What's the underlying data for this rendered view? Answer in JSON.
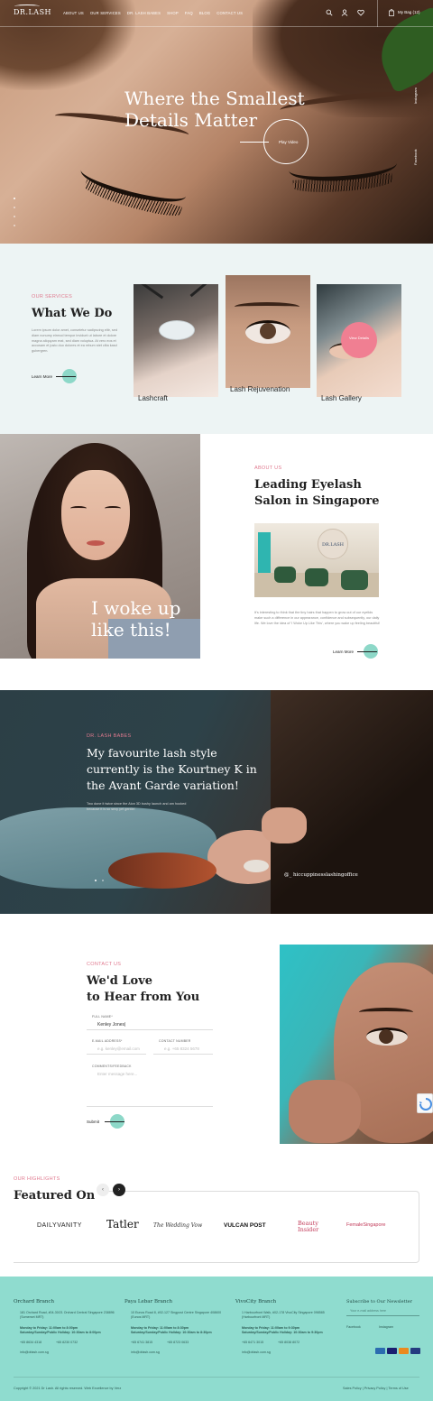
{
  "brand": {
    "logo": "DR.LASH",
    "accent_pink": "#e07a8f",
    "accent_mint": "#8dd8c8",
    "footer_bg": "#8fdccf"
  },
  "nav": {
    "items": [
      "ABOUT US",
      "OUR SERVICES",
      "DR. LASH BABES",
      "SHOP",
      "FAQ",
      "BLOG",
      "CONTACT US"
    ],
    "icons": [
      "search-icon",
      "user-icon",
      "heart-icon"
    ],
    "bag_label": "My Bag (12)"
  },
  "hero": {
    "title_line1": "Where the Smallest",
    "title_line2": "Details Matter",
    "play_label": "Play Video",
    "social_instagram": "Instagram",
    "social_facebook": "Facebook"
  },
  "services": {
    "eyebrow": "OUR SERVICES",
    "title": "What We Do",
    "body": "Lorem ipsum dolor amet, consetetur sadipscing elitr, sed diam nonumy eirmod tempor invidunt ut labore et dolore magna aliquyam erat, sed diam voluptua. At vero eos et accusam et justo duo dolores et ea rebum stet clita kasd gubergren.",
    "learn_more": "Learn More",
    "cards": [
      {
        "label": "Lashcraft"
      },
      {
        "label": "Lash Rejuvenation"
      },
      {
        "label": "Lash Gallery"
      }
    ],
    "view_details": "View Details"
  },
  "about": {
    "photo_caption_line1": "I woke up",
    "photo_caption_line2": "like this!",
    "eyebrow": "ABOUT US",
    "title": "Leading Eyelash Salon in Singapore",
    "salon_sign": "DR.LASH",
    "body": "It's interesting to think that the tiny hairs that happen to grow out of our eyelids make such a difference in our appearance, confidence and subsequently, our daily life. We love the idea of 'I Woke Up Like This', where you wake up feeling beautiful!",
    "learn_more": "Learn More"
  },
  "babes": {
    "eyebrow": "DR. LASH BABES",
    "quote": "My favourite lash style currently is the Kourtney K in the Avant Garde variation!",
    "body": "Two done it twice since the Aion 3D bushy launch and am hooked because it is so sexy yet gentle!",
    "handle": "@_ hiccuppinesslashingoffice"
  },
  "contact": {
    "eyebrow": "CONTACT US",
    "title_line1": "We'd Love",
    "title_line2": "to Hear from You",
    "fields": {
      "full_name_label": "FULL NAME*",
      "full_name_value": "Kenley Jones|",
      "email_label": "E-MAIL ADDRESS*",
      "email_placeholder": "e.g. kenley@email.com",
      "contact_label": "CONTACT NUMBER",
      "contact_placeholder": "e.g. +65 8324 5678",
      "comments_label": "COMMENTS/FEEDBACK",
      "comments_placeholder": "Enter message here..."
    },
    "submit": "Submit"
  },
  "featured": {
    "eyebrow": "OUR HIGHLIGHTS",
    "title": "Featured On",
    "prev_icon": "chevron-left-icon",
    "next_icon": "chevron-right-icon",
    "logos": [
      "DAILYVANITY",
      "Tatler",
      "The Wedding Vow",
      "VULCAN POST",
      "Beauty Insider",
      "FemaleSingapore"
    ]
  },
  "footer": {
    "branches": [
      {
        "name": "Orchard Branch",
        "address": "181 Orchard Road, #04-30/21 Orchard Central Singapore 238896 (Somerset MRT)",
        "hours_weekday": "Monday to Friday: 11:00am to 8:00pm",
        "hours_weekend": "Saturday/Sunday/Public Holiday: 10:30am to 8:00pm",
        "phone": "+65 8634 4318",
        "whatsapp": "+65 8230 0732",
        "email": "info@drlash.com.sg"
      },
      {
        "name": "Paya Lebar Branch",
        "address": "10 Eunos Road 8, #02-127 Singpost Centre Singapore 408600 (Eunos MRT)",
        "hours_weekday": "Monday to Friday: 11:00am to 8:30pm",
        "hours_weekend": "Saturday/Sunday/Public Holiday: 10:30am to 8:30pm",
        "phone": "+65 6741 3815",
        "whatsapp": "+65 8723 0633",
        "email": "info@drlash.com.sg"
      },
      {
        "name": "VivoCity Branch",
        "address": "1 Harbourfront Walk, #02-178 VivoCity Singapore 098585 (Harbourfront MRT)",
        "hours_weekday": "Monday to Friday: 11:00am to 9:30pm",
        "hours_weekend": "Saturday/Sunday/Public Holiday: 10:30am to 9:30pm",
        "phone": "+65 6471 3015",
        "whatsapp": "+65 8038 8072",
        "email": "info@drlash.com.sg"
      }
    ],
    "newsletter_title": "Subscribe to Our Newsletter",
    "newsletter_placeholder": "Your e-mail address here",
    "social_facebook": "Facebook",
    "social_instagram": "Instagram",
    "payment_icons": [
      "amex-icon",
      "visa-icon",
      "mastercard-icon",
      "paypal-icon"
    ],
    "copyright": "Copyright © 2021 Dr Lash. All rights reserved. Web Excellence by Verz",
    "legal": "Sales Policy | Privacy Policy | Terms of Use"
  }
}
